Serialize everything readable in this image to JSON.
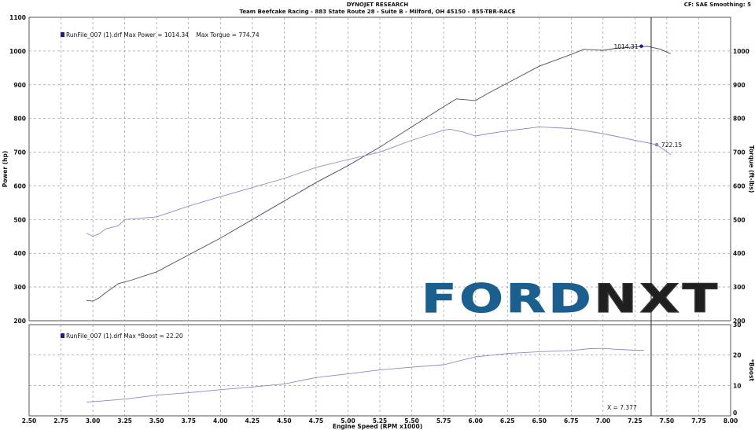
{
  "header": {
    "title": "DYNOJET RESEARCH",
    "subtitle": "Team Beefcake Racing - 883 State Route 28 - Suite B - Milford, OH 45150 - 855-TBR-RACE",
    "settings": "CF: SAE  Smoothing: 5"
  },
  "logo": {
    "text": "FORDNXT",
    "colors": [
      "#1b5f8e",
      "#0b2a43",
      "#1f1f1f"
    ]
  },
  "chart_data": [
    {
      "type": "line",
      "panel": "top",
      "xlabel": "Engine Speed (RPM x1000)",
      "ylabel_left": "Power (hp)",
      "ylabel_right": "Torque (ft-lbs)",
      "xlim": [
        2.5,
        8.0
      ],
      "ylim": [
        200,
        1100
      ],
      "xticks": [
        2.5,
        2.75,
        3.0,
        3.25,
        3.5,
        3.75,
        4.0,
        4.25,
        4.5,
        4.75,
        5.0,
        5.25,
        5.5,
        5.75,
        6.0,
        6.25,
        6.5,
        6.75,
        7.0,
        7.25,
        7.5,
        7.75,
        8.0
      ],
      "xtick_labels": [
        "2.50",
        "2.75",
        "3.00",
        "3.25",
        "3.50",
        "3.75",
        "4.00",
        "4.25",
        "4.50",
        "4.75",
        "5.00",
        "5.25",
        "5.50",
        "5.75",
        "6.00",
        "6.25",
        "6.50",
        "6.75",
        "7.00",
        "7.25",
        "7.50",
        "7.75",
        "8.00"
      ],
      "yticks": [
        200,
        300,
        400,
        500,
        600,
        700,
        800,
        900,
        1000,
        1100
      ],
      "grid": true,
      "legend": "RunFile_007 (1).drf Max Power = 1014.34    Max Torque = 774.74",
      "legend_position": "top-left",
      "series": [
        {
          "color": "#4a4a68",
          "x": [
            2.95,
            3.0,
            3.05,
            3.1,
            3.2,
            3.3,
            3.5,
            3.75,
            4.0,
            4.25,
            4.5,
            4.75,
            5.0,
            5.25,
            5.5,
            5.75,
            5.85,
            6.0,
            6.1,
            6.25,
            6.5,
            6.75,
            6.85,
            7.0,
            7.1,
            7.25,
            7.35,
            7.45,
            7.53
          ],
          "y": [
            260,
            258,
            268,
            283,
            310,
            320,
            345,
            395,
            445,
            500,
            555,
            610,
            660,
            715,
            775,
            835,
            858,
            853,
            875,
            905,
            955,
            990,
            1005,
            1002,
            1008,
            1012,
            1014,
            1005,
            992
          ]
        },
        {
          "color": "#8a8ac8",
          "x": [
            2.95,
            3.0,
            3.05,
            3.1,
            3.2,
            3.25,
            3.5,
            3.75,
            4.0,
            4.25,
            4.5,
            4.75,
            5.0,
            5.25,
            5.5,
            5.75,
            5.8,
            5.9,
            6.0,
            6.1,
            6.25,
            6.5,
            6.75,
            7.0,
            7.25,
            7.42,
            7.53
          ],
          "y": [
            460,
            450,
            458,
            472,
            482,
            500,
            508,
            540,
            568,
            595,
            622,
            655,
            678,
            700,
            735,
            765,
            768,
            760,
            748,
            755,
            763,
            775,
            770,
            755,
            735,
            722,
            693
          ]
        }
      ],
      "markers": [
        {
          "x": 7.3,
          "y": 1014.31,
          "label": "1014.31",
          "color": "#1a1a9a"
        },
        {
          "x": 7.42,
          "y": 722.15,
          "label": "722.15",
          "color": "#8a8ac8"
        }
      ],
      "cursor_x": 7.377
    },
    {
      "type": "line",
      "panel": "bottom",
      "xlabel": "Engine Speed (RPM x1000)",
      "ylabel_right": "*Boost",
      "xlim": [
        2.5,
        8.0
      ],
      "ylim": [
        0,
        30
      ],
      "yticks": [
        0,
        10,
        20,
        30
      ],
      "grid": true,
      "legend": "RunFile_007 (1).drf Max *Boost = 22.20",
      "legend_position": "top-left",
      "series": [
        {
          "color": "#8a8ac8",
          "x": [
            2.95,
            3.1,
            3.25,
            3.5,
            3.75,
            4.0,
            4.25,
            4.5,
            4.75,
            5.0,
            5.25,
            5.5,
            5.75,
            6.0,
            6.25,
            6.5,
            6.75,
            6.9,
            7.0,
            7.1,
            7.25,
            7.32
          ],
          "y": [
            4.5,
            5,
            5.5,
            6.8,
            7.6,
            8.6,
            9.5,
            10.5,
            12.6,
            13.8,
            15.1,
            16,
            16.8,
            19.4,
            20.5,
            21.1,
            21.5,
            22.1,
            22.2,
            21.9,
            21.6,
            21.6
          ]
        }
      ],
      "cursor_label": "X = 7.377"
    }
  ]
}
